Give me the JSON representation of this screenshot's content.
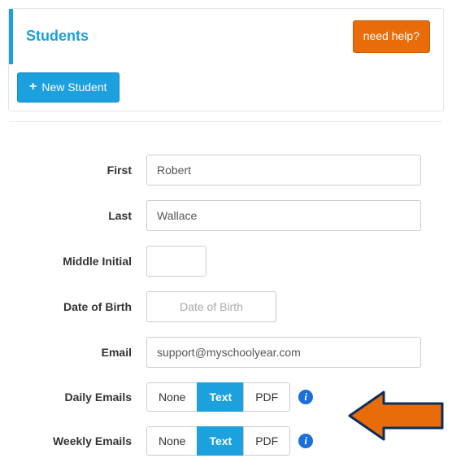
{
  "header": {
    "title": "Students",
    "help_label": "need help?"
  },
  "actions": {
    "new_student_label": "New Student"
  },
  "form": {
    "first": {
      "label": "First",
      "value": "Robert"
    },
    "last": {
      "label": "Last",
      "value": "Wallace"
    },
    "middle": {
      "label": "Middle Initial",
      "value": ""
    },
    "dob": {
      "label": "Date of Birth",
      "value": "",
      "placeholder": "Date of Birth"
    },
    "email": {
      "label": "Email",
      "value": "support@myschoolyear.com"
    },
    "daily": {
      "label": "Daily Emails"
    },
    "weekly": {
      "label": "Weekly Emails"
    },
    "options": {
      "none": "None",
      "text": "Text",
      "pdf": "PDF"
    },
    "daily_selected": "Text",
    "weekly_selected": "Text"
  },
  "colors": {
    "accent": "#1ca0de",
    "warn": "#e86c0a"
  }
}
